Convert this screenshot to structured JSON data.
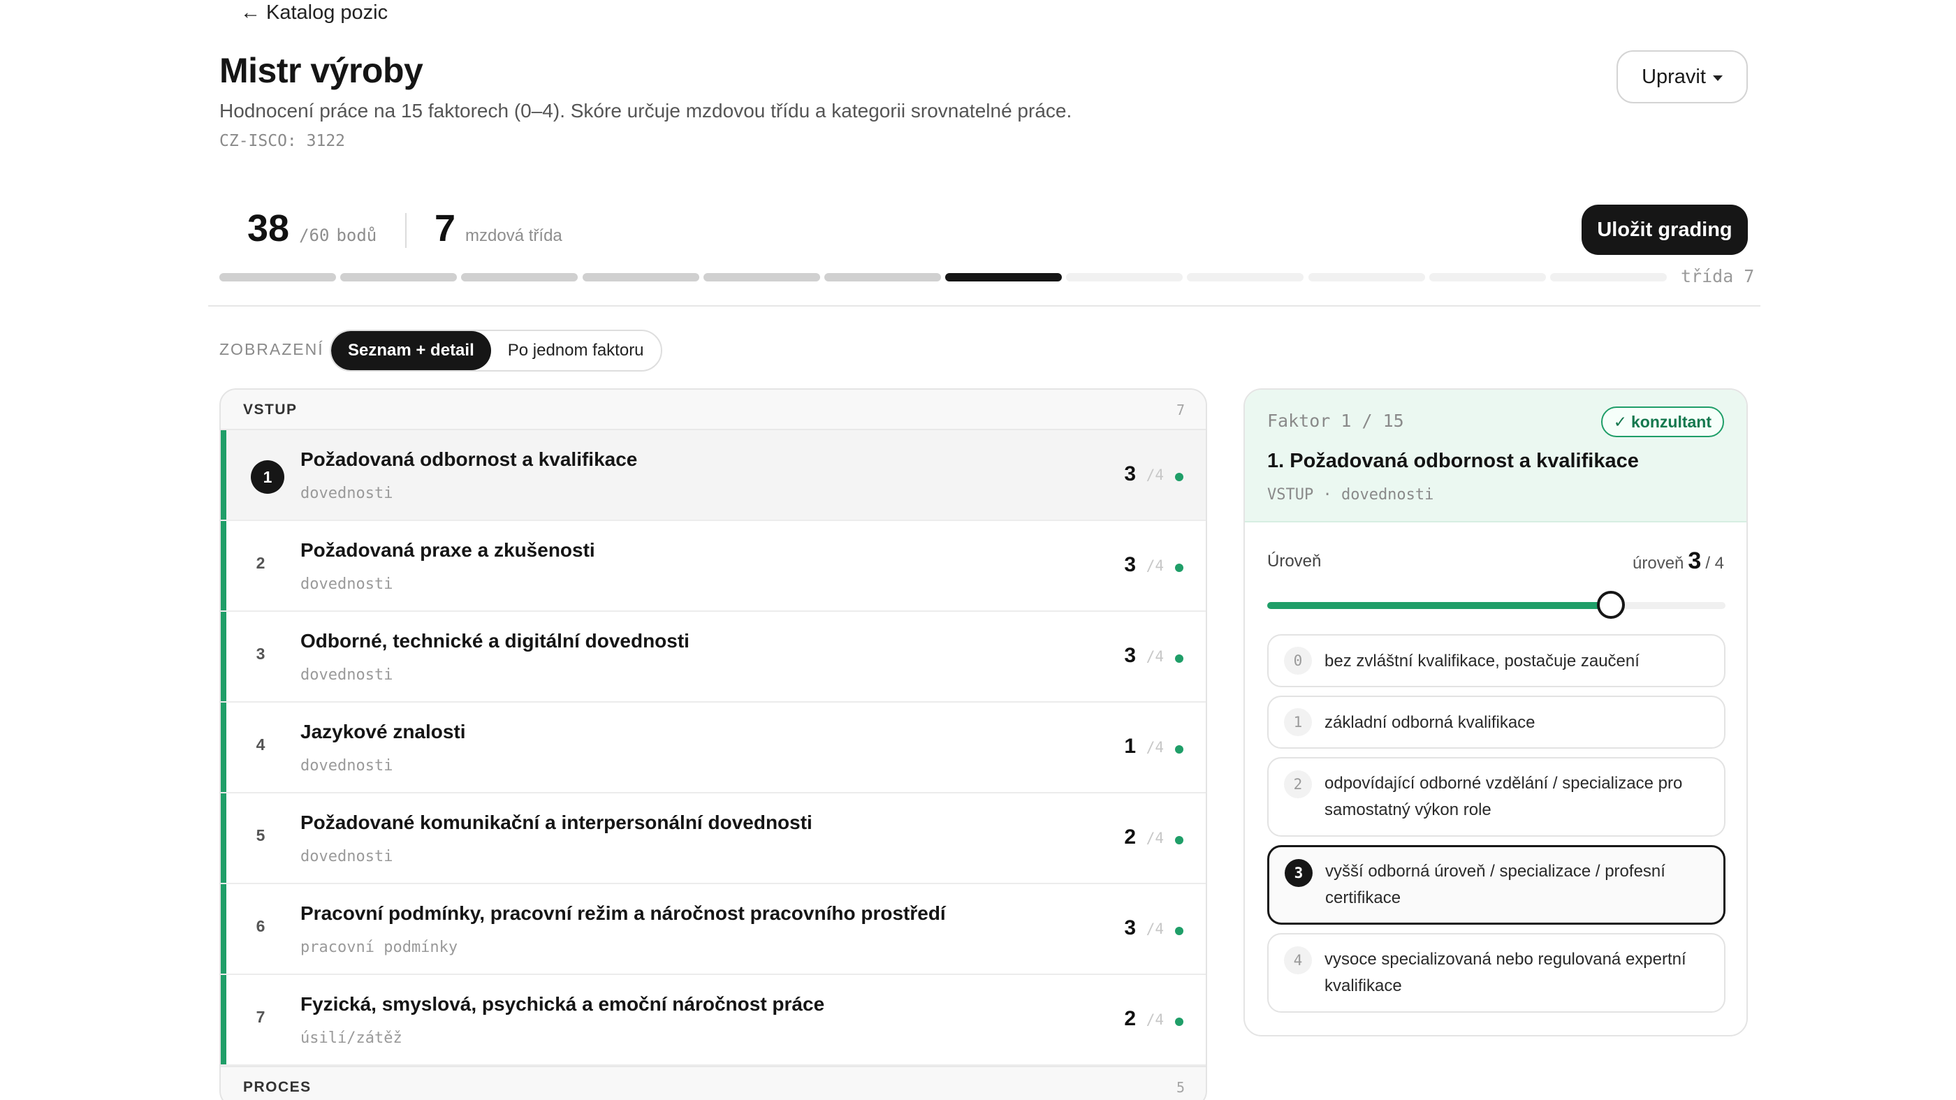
{
  "header": {
    "back_label": "Katalog pozic",
    "back_arrow": "←",
    "title": "Mistr výroby",
    "subtitle": "Hodnocení práce na 15 faktorech (0–4). Skóre určuje mzdovou třídu a kategorii srovnatelné práce.",
    "isco": "CZ-ISCO: 3122",
    "edit_label": "Upravit"
  },
  "score": {
    "points": "38",
    "max": "/60",
    "unit": "bodů",
    "class_value": "7",
    "class_label": "mzdová třída",
    "save_label": "Uložit grading",
    "class_end_label": "třída 7",
    "current_class_index": 6,
    "class_count": 12
  },
  "view": {
    "label": "ZOBRAZENÍ",
    "options": [
      "Seznam + detail",
      "Po jednom faktoru"
    ],
    "active": 0
  },
  "groups": [
    {
      "name": "VSTUP",
      "count": "7"
    },
    {
      "name": "PROCES",
      "count": "5"
    }
  ],
  "factors": [
    {
      "num": "1",
      "title": "Požadovaná odbornost a kvalifikace",
      "category": "dovednosti",
      "score": "3",
      "max": "/4"
    },
    {
      "num": "2",
      "title": "Požadovaná praxe a zkušenosti",
      "category": "dovednosti",
      "score": "3",
      "max": "/4"
    },
    {
      "num": "3",
      "title": "Odborné, technické a digitální dovednosti",
      "category": "dovednosti",
      "score": "3",
      "max": "/4"
    },
    {
      "num": "4",
      "title": "Jazykové znalosti",
      "category": "dovednosti",
      "score": "1",
      "max": "/4"
    },
    {
      "num": "5",
      "title": "Požadované komunikační a interpersonální dovednosti",
      "category": "dovednosti",
      "score": "2",
      "max": "/4"
    },
    {
      "num": "6",
      "title": "Pracovní podmínky, pracovní režim a náročnost pracovního prostředí",
      "category": "pracovní podmínky",
      "score": "3",
      "max": "/4"
    },
    {
      "num": "7",
      "title": "Fyzická, smyslová, psychická a emoční náročnost práce",
      "category": "úsilí/zátěž",
      "score": "2",
      "max": "/4"
    }
  ],
  "detail": {
    "factor_index": "Faktor 1 / 15",
    "consultant_badge": "konzultant",
    "check_icon": "✓",
    "title": "1. Požadovaná odbornost a kvalifikace",
    "meta": "VSTUP · dovednosti",
    "level_label": "Úroveň",
    "level_prefix": "úroveň",
    "level_value": "3",
    "level_max": "/ 4",
    "level_fraction": 0.75,
    "options": [
      {
        "num": "0",
        "text": "bez zvláštní kvalifikace, postačuje zaučení"
      },
      {
        "num": "1",
        "text": "základní odborná kvalifikace"
      },
      {
        "num": "2",
        "text": "odpovídající odborné vzdělání / specializace pro samostatný výkon role"
      },
      {
        "num": "3",
        "text": "vyšší odborná úroveň / specializace / profesní certifikace"
      },
      {
        "num": "4",
        "text": "vysoce specializovaná nebo regulovaná expertní kvalifikace"
      }
    ],
    "selected_option": 3
  },
  "colors": {
    "accent_green": "#1f9e68",
    "dark": "#161616",
    "panel_tint": "#ebf8f1",
    "bar_filled": "#d0d0d0",
    "bar_current": "#161616",
    "bar_empty": "#f1f1f1"
  }
}
